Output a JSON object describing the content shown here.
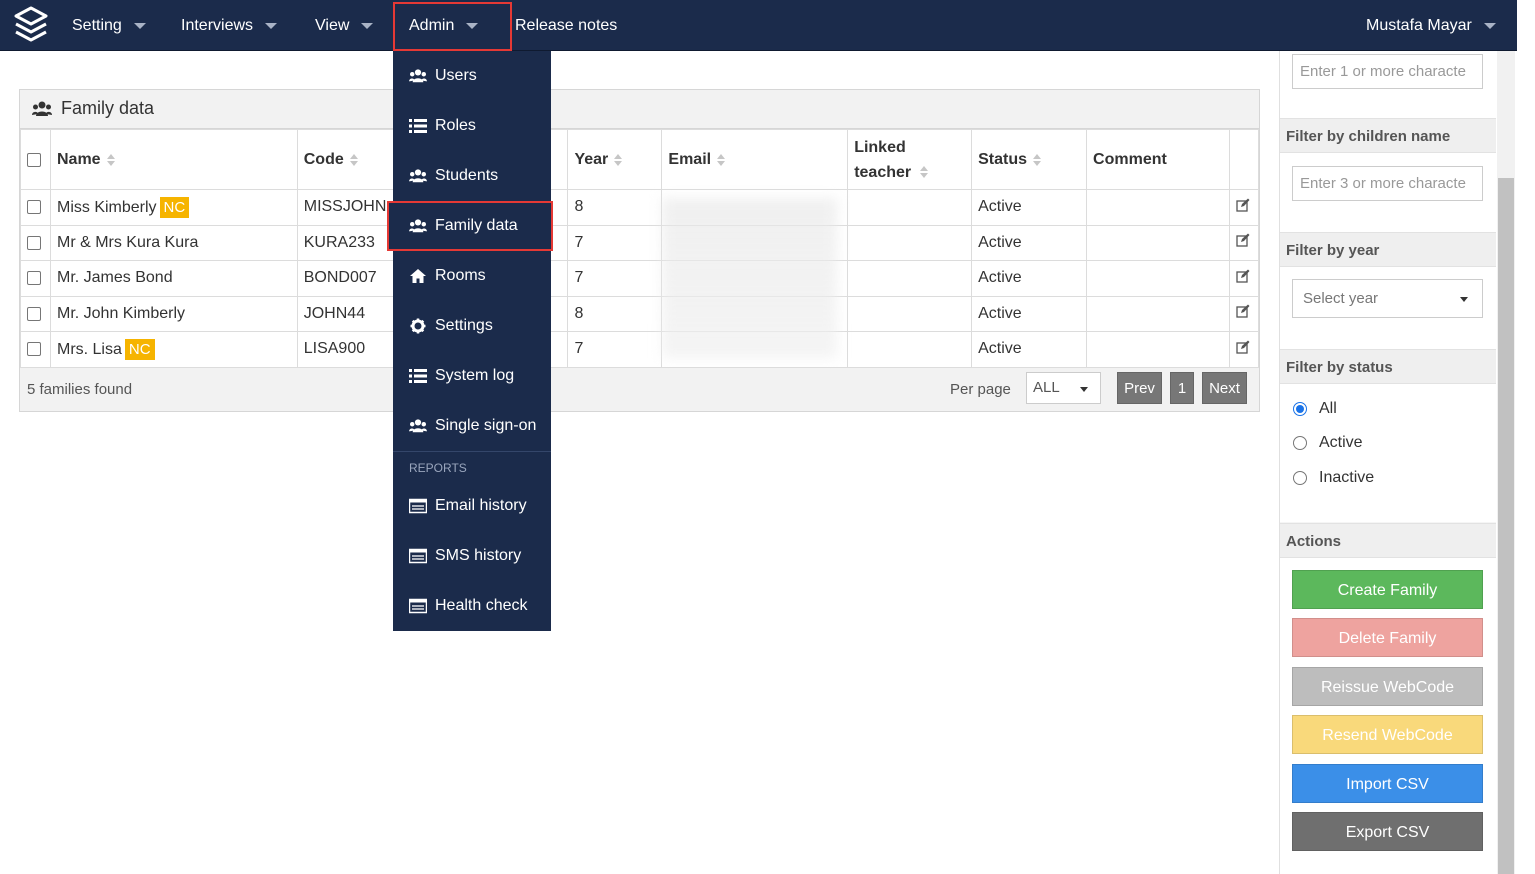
{
  "navbar": {
    "menu": [
      "Setting",
      "Interviews",
      "View",
      "Admin",
      "Release notes"
    ],
    "user": "Mustafa Mayar"
  },
  "panel": {
    "title": "Family data",
    "columns": [
      "Name",
      "Code",
      "Year",
      "Email",
      "Linked teacher",
      "Status",
      "Comment"
    ],
    "rows": [
      {
        "name": "Miss Kimberly",
        "badge": "NC",
        "code": "MISSJOHN",
        "year": "8",
        "status": "Active"
      },
      {
        "name": "Mr & Mrs Kura Kura",
        "badge": "",
        "code": "KURA233",
        "year": "7",
        "status": "Active"
      },
      {
        "name": "Mr. James Bond",
        "badge": "",
        "code": "BOND007",
        "year": "7",
        "status": "Active"
      },
      {
        "name": "Mr. John Kimberly",
        "badge": "",
        "code": "JOHN44",
        "year": "8",
        "status": "Active"
      },
      {
        "name": "Mrs. Lisa",
        "badge": "NC",
        "code": "LISA900",
        "year": "7",
        "status": "Active"
      }
    ],
    "count_text": "5 families found",
    "per_page_label": "Per page",
    "per_page_value": "ALL",
    "pagination": {
      "prev": "Prev",
      "page": "1",
      "next": "Next"
    }
  },
  "admin_menu": {
    "items": [
      "Users",
      "Roles",
      "Students",
      "Family data",
      "Rooms",
      "Settings",
      "System log",
      "Single sign-on"
    ],
    "reports_heading": "REPORTS",
    "reports": [
      "Email history",
      "SMS history",
      "Health check"
    ],
    "active": "Family data"
  },
  "sidebar": {
    "top_input_placeholder": "Enter 1 or more characte",
    "children_title": "Filter by children name",
    "children_placeholder": "Enter 3 or more characte",
    "year_title": "Filter by year",
    "year_placeholder": "Select year",
    "status_title": "Filter by status",
    "status_options": [
      "All",
      "Active",
      "Inactive"
    ],
    "status_selected": "All",
    "actions_title": "Actions",
    "actions": [
      {
        "label": "Create Family",
        "color": "#5cb85c"
      },
      {
        "label": "Delete Family",
        "color": "#eea39f"
      },
      {
        "label": "Reissue WebCode",
        "color": "#bdbdbd"
      },
      {
        "label": "Resend WebCode",
        "color": "#f9d97b"
      },
      {
        "label": "Import CSV",
        "color": "#3b8fe8"
      },
      {
        "label": "Export CSV",
        "color": "#6f6f6f"
      }
    ]
  }
}
